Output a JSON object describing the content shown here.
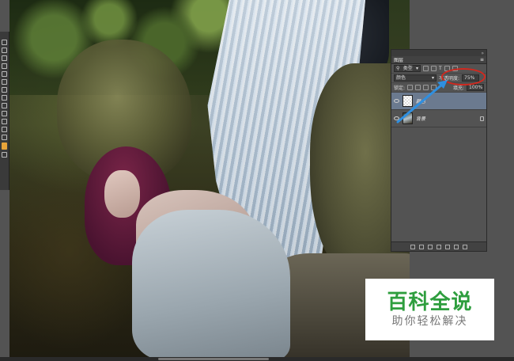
{
  "canvas": {
    "description_icon": "photo-canvas"
  },
  "layers_panel": {
    "tab_label": "图层",
    "filter_kind": "类型",
    "blend_mode": "颜色",
    "opacity_label": "不透明度:",
    "opacity_value": "75%",
    "lock_label": "锁定:",
    "fill_label": "填充:",
    "fill_value": "100%",
    "layers": [
      {
        "name": "颜色",
        "selected": true,
        "thumb": "transparent"
      },
      {
        "name": "背景",
        "selected": false,
        "thumb": "photo",
        "locked": true
      }
    ]
  },
  "annotation": {
    "color": "#d2281e",
    "arrow_color": "#2f8fe0"
  },
  "watermark": {
    "title": "百科全说",
    "subtitle": "助你轻松解决",
    "title_color": "#2e9e3e"
  }
}
